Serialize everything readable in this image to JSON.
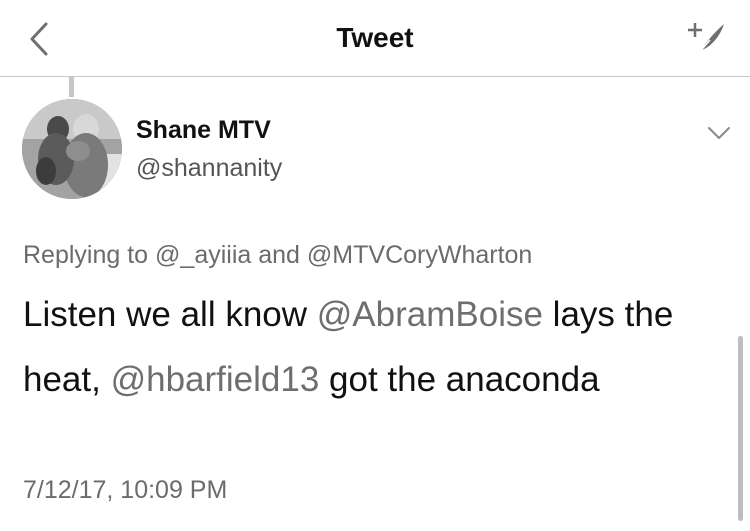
{
  "nav": {
    "title": "Tweet",
    "back_icon": "chevron-left-icon",
    "compose_icon": "compose-feather-icon"
  },
  "tweet": {
    "author": {
      "name": "Shane MTV",
      "handle": "@shannanity"
    },
    "replying_to": {
      "prefix": "Replying to",
      "users": [
        "@_ayiiia",
        "@MTVCoryWharton"
      ],
      "joiner": "and"
    },
    "text": {
      "part1": "Listen we all know ",
      "mention1": "@AbramBoise",
      "part2": " lays the heat, ",
      "mention2": "@hbarfield13",
      "part3": " got the anaconda"
    },
    "timestamp": "7/12/17, 10:09 PM"
  },
  "colors": {
    "text": "#111111",
    "secondary_text": "#6b6b6b",
    "mention": "#6e6e6e",
    "divider": "#c8c8c8"
  }
}
